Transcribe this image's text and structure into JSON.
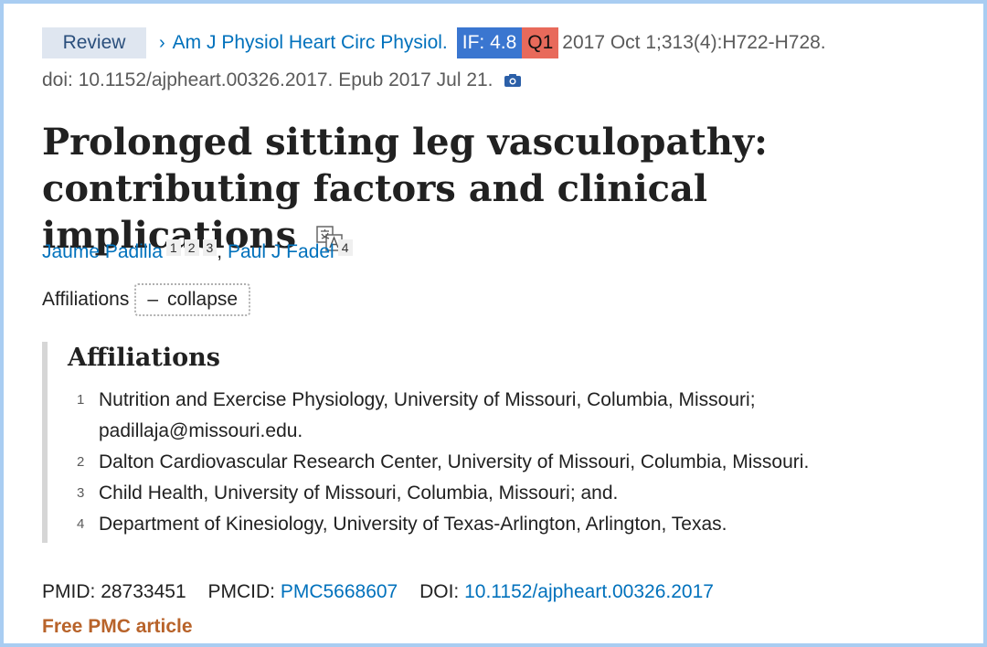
{
  "header": {
    "review_badge": "Review",
    "journal": "Am J Physiol Heart Circ Physiol.",
    "if_badge": "IF: 4.8",
    "quartile_badge": "Q1",
    "citation": "2017 Oct 1;313(4):H722-H728.",
    "doi_epub": "doi: 10.1152/ajpheart.00326.2017. Epub 2017 Jul 21.",
    "camera_icon": "camera-icon"
  },
  "article": {
    "title": "Prolonged sitting leg vasculopathy: contributing factors and clinical implications",
    "translate_icon": "translate-icon"
  },
  "authors": [
    {
      "name": "Jaume Padilla",
      "affiliations": [
        "1",
        "2",
        "3"
      ]
    },
    {
      "name": "Paul J Fadel",
      "affiliations": [
        "4"
      ]
    }
  ],
  "author_separator": ",",
  "affiliations_toggle": {
    "label": "Affiliations",
    "button_symbol": "–",
    "button_label": "collapse"
  },
  "affiliations": {
    "heading": "Affiliations",
    "items": [
      {
        "num": "1",
        "text": "Nutrition and Exercise Physiology, University of Missouri, Columbia, Missouri;",
        "text2": "padillaja@missouri.edu."
      },
      {
        "num": "2",
        "text": "Dalton Cardiovascular Research Center, University of Missouri, Columbia, Missouri."
      },
      {
        "num": "3",
        "text": "Child Health, University of Missouri, Columbia, Missouri; and."
      },
      {
        "num": "4",
        "text": "Department of Kinesiology, University of Texas-Arlington, Arlington, Texas."
      }
    ]
  },
  "identifiers": {
    "pmid_label": "PMID:",
    "pmid": "28733451",
    "pmcid_label": "PMCID:",
    "pmcid": "PMC5668607",
    "doi_label": "DOI:",
    "doi": "10.1152/ajpheart.00326.2017"
  },
  "free_pmc": "Free PMC article",
  "colors": {
    "link": "#0071bc",
    "if_badge": "#3a76d0",
    "q1_badge": "#e86a5b",
    "free_pmc": "#b8632a",
    "frame": "#a9cdf2"
  }
}
